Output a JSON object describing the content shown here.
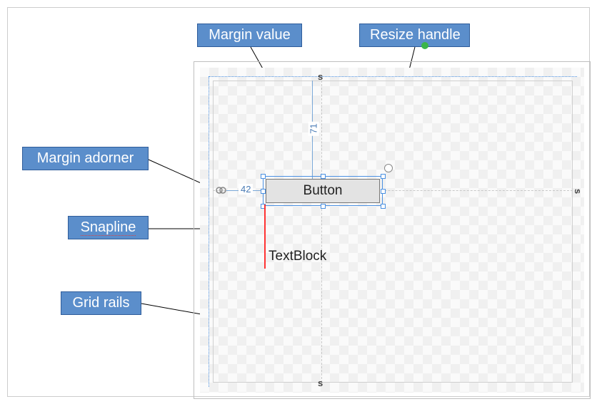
{
  "callouts": {
    "margin_value": "Margin value",
    "resize_handle": "Resize handle",
    "margin_adorner": "Margin adorner",
    "snapline": "Snapline",
    "grid_rails": "Grid rails"
  },
  "designer": {
    "button_label": "Button",
    "textblock_label": "TextBlock",
    "margin_top_value": "71",
    "margin_left_value": "42"
  }
}
